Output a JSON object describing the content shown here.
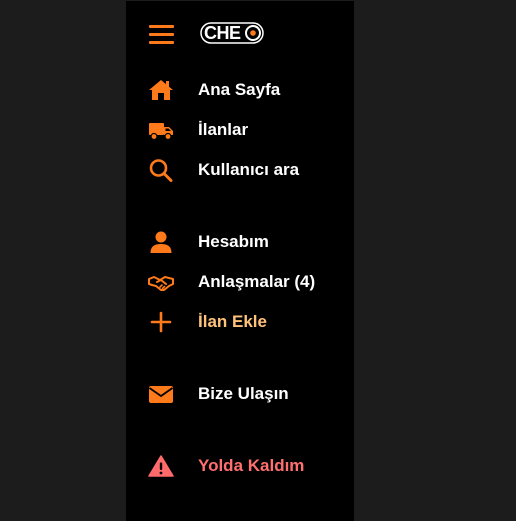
{
  "logo": {
    "text": "CHE"
  },
  "colors": {
    "accent": "#ff7a1a",
    "background": "#000000",
    "highlight_text": "#ffc27a",
    "danger_text": "#ff6f6f",
    "danger_icon": "#ff6b6b"
  },
  "menu": {
    "home": {
      "label": "Ana Sayfa",
      "icon": "home-icon"
    },
    "listings": {
      "label": "İlanlar",
      "icon": "truck-icon"
    },
    "search_user": {
      "label": "Kullanıcı ara",
      "icon": "search-icon"
    },
    "account": {
      "label": "Hesabım",
      "icon": "user-icon"
    },
    "deals": {
      "label": "Anlaşmalar (4)",
      "icon": "handshake-icon"
    },
    "add_listing": {
      "label": "İlan Ekle",
      "icon": "plus-icon"
    },
    "contact": {
      "label": "Bize Ulaşın",
      "icon": "envelope-icon"
    },
    "stuck": {
      "label": "Yolda Kaldım",
      "icon": "warning-icon"
    }
  }
}
